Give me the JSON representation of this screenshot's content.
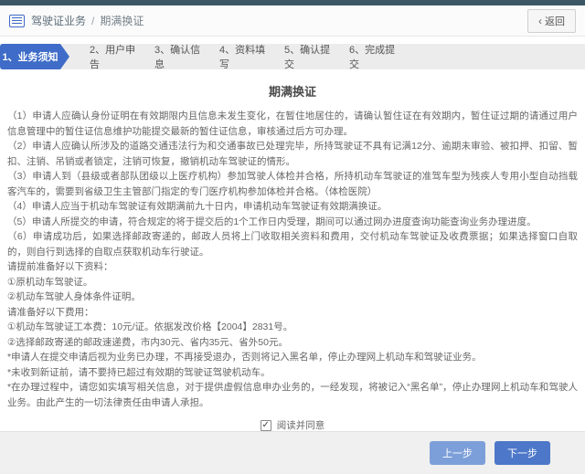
{
  "header": {
    "breadcrumb_section": "驾驶证业务",
    "breadcrumb_sep": "/",
    "breadcrumb_page": "期满换证",
    "back_arrow": "‹",
    "back_label": "返回"
  },
  "steps": {
    "items": [
      {
        "label": "1、业务须知",
        "active": true
      },
      {
        "label": "2、用户申告",
        "active": false
      },
      {
        "label": "3、确认信息",
        "active": false
      },
      {
        "label": "4、资料填写",
        "active": false
      },
      {
        "label": "5、确认提交",
        "active": false
      },
      {
        "label": "6、完成提交",
        "active": false
      }
    ]
  },
  "content": {
    "title": "期满换证",
    "paragraphs": [
      "（1）申请人应确认身份证明在有效期限内且信息未发生变化，在暂住地居住的，请确认暂住证在有效期内，暂住证过期的请通过用户信息管理中的暂住证信息维护功能提交最新的暂住证信息，审核通过后方可办理。",
      "（2）申请人应确认所涉及的道路交通违法行为和交通事故已处理完毕，所持驾驶证不具有记满12分、逾期未审验、被扣押、扣留、暂扣、注销、吊销或者锁定，注销可恢复，撤销机动车驾驶证的情形。",
      "（3）申请人到（县级或者部队团级以上医疗机构）参加驾驶人体检并合格，所持机动车驾驶证的准驾车型为残疾人专用小型自动挡载客汽车的，需要到省级卫生主管部门指定的专门医疗机构参加体检并合格。（体检医院）",
      "（4）申请人应当于机动车驾驶证有效期满前九十日内，申请机动车驾驶证有效期满换证。",
      "（5）申请人所提交的申请，符合规定的将于提交后的1个工作日内受理，期间可以通过网办进度查询功能查询业务办理进度。",
      "（6）申请成功后，如果选择邮政寄递的，邮政人员将上门收取相关资料和费用，交付机动车驾驶证及收费票据；如果选择窗口自取的，则自行到选择的自取点获取机动车行驶证。",
      "请提前准备好以下资料：",
      "①原机动车驾驶证。",
      "②机动车驾驶人身体条件证明。",
      "请准备好以下费用：",
      "①机动车驾驶证工本费：10元/证。依据发改价格【2004】2831号。",
      "②选择邮政寄递的邮政速递费，市内30元、省内35元、省外50元。",
      "*申请人在提交申请后视为业务已办理，不再接受退办，否则将记入黑名单，停止办理网上机动车和驾驶证业务。",
      "*未收到新证前，请不要持已超过有效期的驾驶证驾驶机动车。",
      "*在办理过程中，请您如实填写相关信息，对于提供虚假信息申办业务的，一经发现，将被记入“黑名单”，停止办理网上机动车和驾驶人业务。由此产生的一切法律责任由申请人承担。"
    ],
    "agree_check_glyph": "✓",
    "agree_checked": true,
    "agree_label": "阅读并同意"
  },
  "footer": {
    "prev_label": "上一步",
    "next_label": "下一步"
  },
  "colors": {
    "topbar": "#3b5765",
    "accent_blue": "#3e6cc8",
    "prev_button": "#7d9fd9",
    "next_button": "#4d77c8",
    "step_bar_bg": "#ececec",
    "footer_bg": "#f0f0f0"
  }
}
